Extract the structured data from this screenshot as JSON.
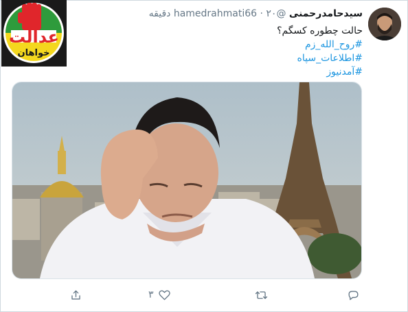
{
  "tweet": {
    "author_name": "سیدحامدرحمنی",
    "author_handle": "@hamedrahmati66",
    "separator": "·",
    "time": "۲۰ دقیقه",
    "text": "حالت چطوره کسگم؟",
    "hashtags": [
      "#روح_الله_زم",
      "#اطلاعات_سپاه",
      "#آمدنیوز"
    ]
  },
  "logo": {
    "word_main": "عدالت",
    "word_sub": "خواهان",
    "colors": {
      "green": "#2e9b3c",
      "red": "#e0262b",
      "yellow": "#f4d81e"
    }
  },
  "actions": {
    "reply_count": "",
    "retweet_count": "",
    "like_count": "۳",
    "share_count": ""
  },
  "icons": [
    "reply-icon",
    "retweet-icon",
    "like-icon",
    "share-icon",
    "fist-icon"
  ],
  "colors": {
    "link": "#1b95e0",
    "muted": "#657786",
    "text": "#14171a"
  }
}
